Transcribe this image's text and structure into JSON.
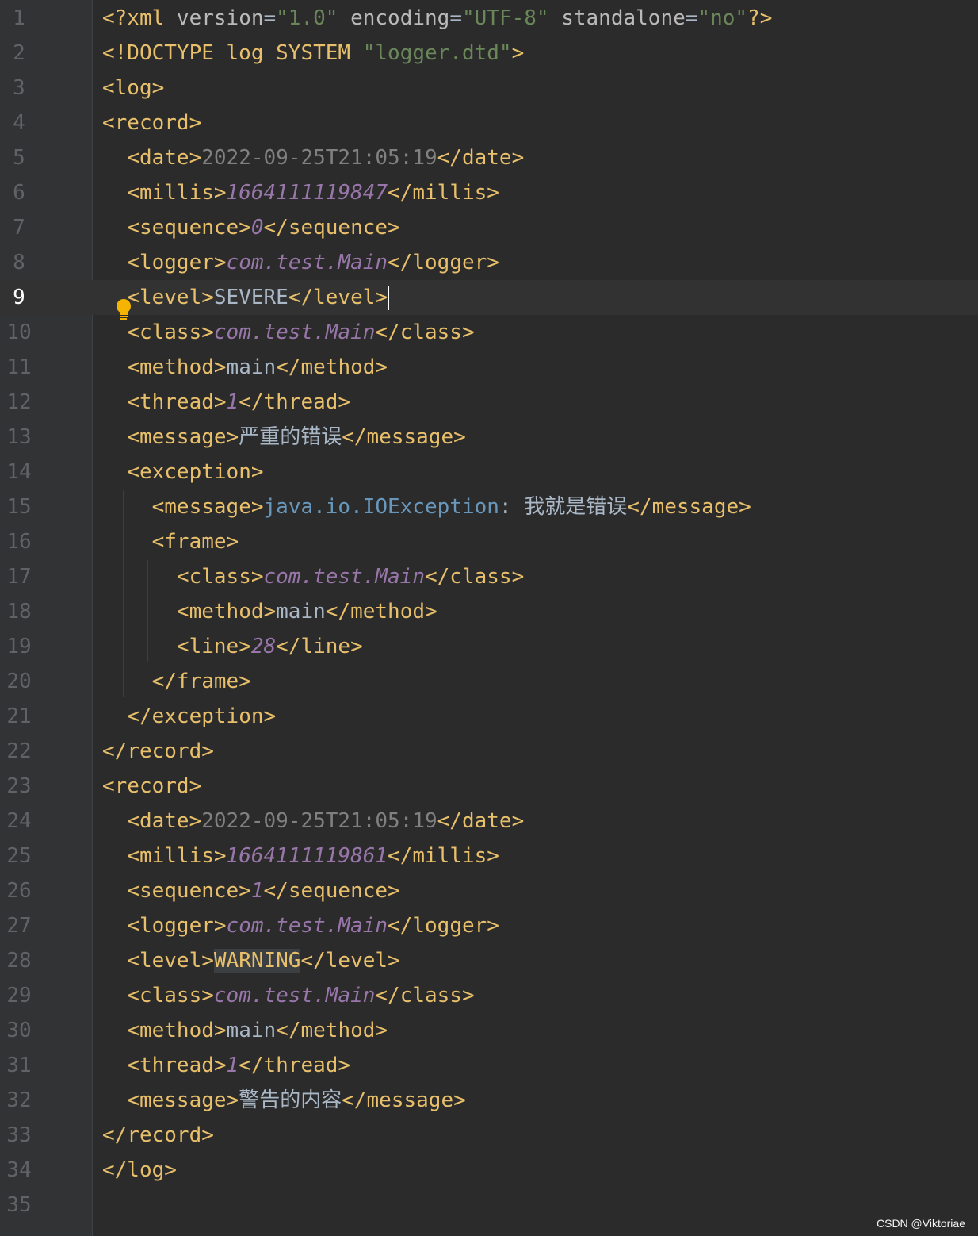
{
  "editor": {
    "file_language": "xml",
    "current_line": 9,
    "colors": {
      "background": "#2b2b2b",
      "gutter": "#313335",
      "tag": "#e8bf6a",
      "string": "#6a8759",
      "number": "#9876aa",
      "text": "#a9b7c6"
    }
  },
  "lines": [
    {
      "n": "1",
      "tokens": [
        [
          "tag",
          "<?xml "
        ],
        [
          "attr",
          "version"
        ],
        [
          "plain",
          "="
        ],
        [
          "str",
          "\"1.0\""
        ],
        [
          "plain",
          " "
        ],
        [
          "attr",
          "encoding"
        ],
        [
          "plain",
          "="
        ],
        [
          "str",
          "\"UTF-8\""
        ],
        [
          "plain",
          " "
        ],
        [
          "attr",
          "standalone"
        ],
        [
          "plain",
          "="
        ],
        [
          "str",
          "\"no\""
        ],
        [
          "tag",
          "?>"
        ]
      ]
    },
    {
      "n": "2",
      "tokens": [
        [
          "tag",
          "<!DOCTYPE log SYSTEM "
        ],
        [
          "str",
          "\"logger.dtd\""
        ],
        [
          "tag",
          ">"
        ]
      ]
    },
    {
      "n": "3",
      "tokens": [
        [
          "tag",
          "<log>"
        ]
      ]
    },
    {
      "n": "4",
      "tokens": [
        [
          "tag",
          "<record>"
        ]
      ]
    },
    {
      "n": "5",
      "tokens": [
        [
          "plain",
          "  "
        ],
        [
          "tag",
          "<date>"
        ],
        [
          "date",
          "2022-09-25T21:05:19"
        ],
        [
          "tag",
          "</date>"
        ]
      ]
    },
    {
      "n": "6",
      "tokens": [
        [
          "plain",
          "  "
        ],
        [
          "tag",
          "<millis>"
        ],
        [
          "num",
          "1664111119847"
        ],
        [
          "tag",
          "</millis>"
        ]
      ]
    },
    {
      "n": "7",
      "tokens": [
        [
          "plain",
          "  "
        ],
        [
          "tag",
          "<sequence>"
        ],
        [
          "num",
          "0"
        ],
        [
          "tag",
          "</sequence>"
        ]
      ]
    },
    {
      "n": "8",
      "tokens": [
        [
          "plain",
          "  "
        ],
        [
          "tag",
          "<logger>"
        ],
        [
          "cls",
          "com.test.Main"
        ],
        [
          "tag",
          "</logger>"
        ]
      ]
    },
    {
      "n": "9",
      "tokens": [
        [
          "plain",
          "  "
        ],
        [
          "tag",
          "<level>"
        ],
        [
          "val",
          "SEVERE"
        ],
        [
          "tag",
          "</level>"
        ]
      ]
    },
    {
      "n": "10",
      "tokens": [
        [
          "plain",
          "  "
        ],
        [
          "tag",
          "<class>"
        ],
        [
          "cls",
          "com.test.Main"
        ],
        [
          "tag",
          "</class>"
        ]
      ]
    },
    {
      "n": "11",
      "tokens": [
        [
          "plain",
          "  "
        ],
        [
          "tag",
          "<method>"
        ],
        [
          "val",
          "main"
        ],
        [
          "tag",
          "</method>"
        ]
      ]
    },
    {
      "n": "12",
      "tokens": [
        [
          "plain",
          "  "
        ],
        [
          "tag",
          "<thread>"
        ],
        [
          "num",
          "1"
        ],
        [
          "tag",
          "</thread>"
        ]
      ]
    },
    {
      "n": "13",
      "tokens": [
        [
          "plain",
          "  "
        ],
        [
          "tag",
          "<message>"
        ],
        [
          "cjk",
          "严重的错误"
        ],
        [
          "tag",
          "</message>"
        ]
      ]
    },
    {
      "n": "14",
      "tokens": [
        [
          "plain",
          "  "
        ],
        [
          "tag",
          "<exception>"
        ]
      ]
    },
    {
      "n": "15",
      "tokens": [
        [
          "plain",
          "    "
        ],
        [
          "tag",
          "<message>"
        ],
        [
          "java",
          "java.io.IOException"
        ],
        [
          "val",
          ": "
        ],
        [
          "cjk",
          "我就是错误"
        ],
        [
          "tag",
          "</message>"
        ]
      ]
    },
    {
      "n": "16",
      "tokens": [
        [
          "plain",
          "    "
        ],
        [
          "tag",
          "<frame>"
        ]
      ]
    },
    {
      "n": "17",
      "tokens": [
        [
          "plain",
          "      "
        ],
        [
          "tag",
          "<class>"
        ],
        [
          "cls",
          "com.test.Main"
        ],
        [
          "tag",
          "</class>"
        ]
      ]
    },
    {
      "n": "18",
      "tokens": [
        [
          "plain",
          "      "
        ],
        [
          "tag",
          "<method>"
        ],
        [
          "val",
          "main"
        ],
        [
          "tag",
          "</method>"
        ]
      ]
    },
    {
      "n": "19",
      "tokens": [
        [
          "plain",
          "      "
        ],
        [
          "tag",
          "<line>"
        ],
        [
          "num",
          "28"
        ],
        [
          "tag",
          "</line>"
        ]
      ]
    },
    {
      "n": "20",
      "tokens": [
        [
          "plain",
          "    "
        ],
        [
          "tag",
          "</frame>"
        ]
      ]
    },
    {
      "n": "21",
      "tokens": [
        [
          "plain",
          "  "
        ],
        [
          "tag",
          "</exception>"
        ]
      ]
    },
    {
      "n": "22",
      "tokens": [
        [
          "tag",
          "</record>"
        ]
      ]
    },
    {
      "n": "23",
      "tokens": [
        [
          "tag",
          "<record>"
        ]
      ]
    },
    {
      "n": "24",
      "tokens": [
        [
          "plain",
          "  "
        ],
        [
          "tag",
          "<date>"
        ],
        [
          "date",
          "2022-09-25T21:05:19"
        ],
        [
          "tag",
          "</date>"
        ]
      ]
    },
    {
      "n": "25",
      "tokens": [
        [
          "plain",
          "  "
        ],
        [
          "tag",
          "<millis>"
        ],
        [
          "num",
          "1664111119861"
        ],
        [
          "tag",
          "</millis>"
        ]
      ]
    },
    {
      "n": "26",
      "tokens": [
        [
          "plain",
          "  "
        ],
        [
          "tag",
          "<sequence>"
        ],
        [
          "num",
          "1"
        ],
        [
          "tag",
          "</sequence>"
        ]
      ]
    },
    {
      "n": "27",
      "tokens": [
        [
          "plain",
          "  "
        ],
        [
          "tag",
          "<logger>"
        ],
        [
          "cls",
          "com.test.Main"
        ],
        [
          "tag",
          "</logger>"
        ]
      ]
    },
    {
      "n": "28",
      "tokens": [
        [
          "plain",
          "  "
        ],
        [
          "tag",
          "<level>"
        ],
        [
          "hl",
          "WARNING"
        ],
        [
          "tag",
          "</level>"
        ]
      ]
    },
    {
      "n": "29",
      "tokens": [
        [
          "plain",
          "  "
        ],
        [
          "tag",
          "<class>"
        ],
        [
          "cls",
          "com.test.Main"
        ],
        [
          "tag",
          "</class>"
        ]
      ]
    },
    {
      "n": "30",
      "tokens": [
        [
          "plain",
          "  "
        ],
        [
          "tag",
          "<method>"
        ],
        [
          "val",
          "main"
        ],
        [
          "tag",
          "</method>"
        ]
      ]
    },
    {
      "n": "31",
      "tokens": [
        [
          "plain",
          "  "
        ],
        [
          "tag",
          "<thread>"
        ],
        [
          "num",
          "1"
        ],
        [
          "tag",
          "</thread>"
        ]
      ]
    },
    {
      "n": "32",
      "tokens": [
        [
          "plain",
          "  "
        ],
        [
          "tag",
          "<message>"
        ],
        [
          "cjk",
          "警告的内容"
        ],
        [
          "tag",
          "</message>"
        ]
      ]
    },
    {
      "n": "33",
      "tokens": [
        [
          "tag",
          "</record>"
        ]
      ]
    },
    {
      "n": "34",
      "tokens": [
        [
          "tag",
          "</log>"
        ]
      ]
    },
    {
      "n": "35",
      "tokens": []
    }
  ],
  "watermark": "CSDN @Viktoriae",
  "icons": {
    "intention": "lightbulb-icon"
  }
}
